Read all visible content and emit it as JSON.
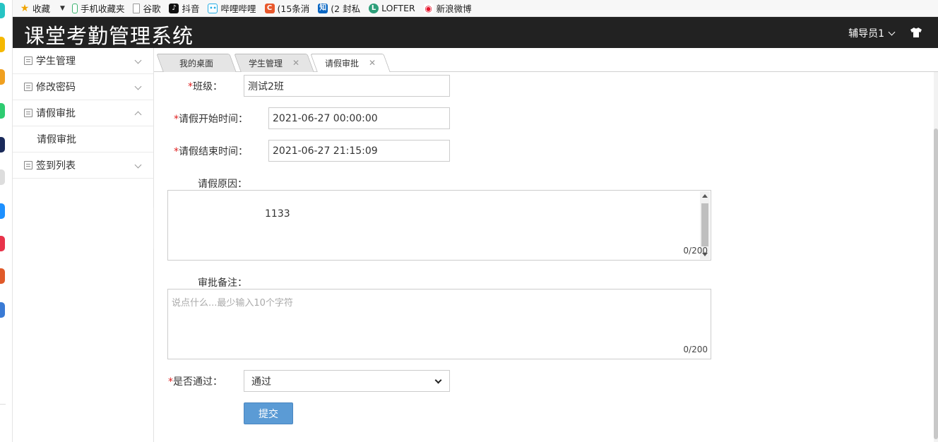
{
  "bookmarks": [
    {
      "label": "收藏",
      "icon": "star-icon",
      "color": "#f0a400"
    },
    {
      "label": "手机收藏夹",
      "icon": "phone-icon",
      "color": "#3cb371"
    },
    {
      "label": "谷歌",
      "icon": "page-icon",
      "color": "#999999"
    },
    {
      "label": "抖音",
      "icon": "douyin-icon",
      "color": "#111111"
    },
    {
      "label": "哔哩哔哩",
      "icon": "bilibili-icon",
      "color": "#23ade5"
    },
    {
      "label": "(15条消",
      "icon": "csdn-icon",
      "color": "#e8582c"
    },
    {
      "label": "(2 封私",
      "icon": "zhihu-icon",
      "color": "#0a66c2"
    },
    {
      "label": "LOFTER",
      "icon": "lofter-icon",
      "color": "#2e9f7a"
    },
    {
      "label": "新浪微博",
      "icon": "weibo-icon",
      "color": "#e6162d"
    }
  ],
  "header": {
    "title": "课堂考勤管理系统",
    "user": "辅导员1"
  },
  "sidebar": {
    "items": [
      {
        "label": "学生管理",
        "expanded": false
      },
      {
        "label": "修改密码",
        "expanded": false
      },
      {
        "label": "请假审批",
        "expanded": true,
        "children": [
          "请假审批"
        ]
      },
      {
        "label": "签到列表",
        "expanded": false
      }
    ]
  },
  "tabs": [
    {
      "label": "我的桌面",
      "closable": false,
      "active": false
    },
    {
      "label": "学生管理",
      "closable": true,
      "active": false
    },
    {
      "label": "请假审批",
      "closable": true,
      "active": true
    }
  ],
  "form": {
    "class_label": "班级：",
    "class_value": "测试2班",
    "start_label": "请假开始时间：",
    "start_value": "2021-06-27 00:00:00",
    "end_label": "请假结束时间：",
    "end_value": "2021-06-27 21:15:09",
    "reason_label": "请假原因：",
    "reason_value": "1133",
    "reason_counter": "0/200",
    "remark_label": "审批备注：",
    "remark_placeholder": "说点什么...最少输入10个字符",
    "remark_counter": "0/200",
    "approve_label": "是否通过：",
    "approve_value": "通过",
    "submit_label": "提交",
    "required_mark": "*"
  },
  "colors": {
    "header_bg": "#222222",
    "submit_bg": "#5b9bd5",
    "required": "#e02020"
  }
}
